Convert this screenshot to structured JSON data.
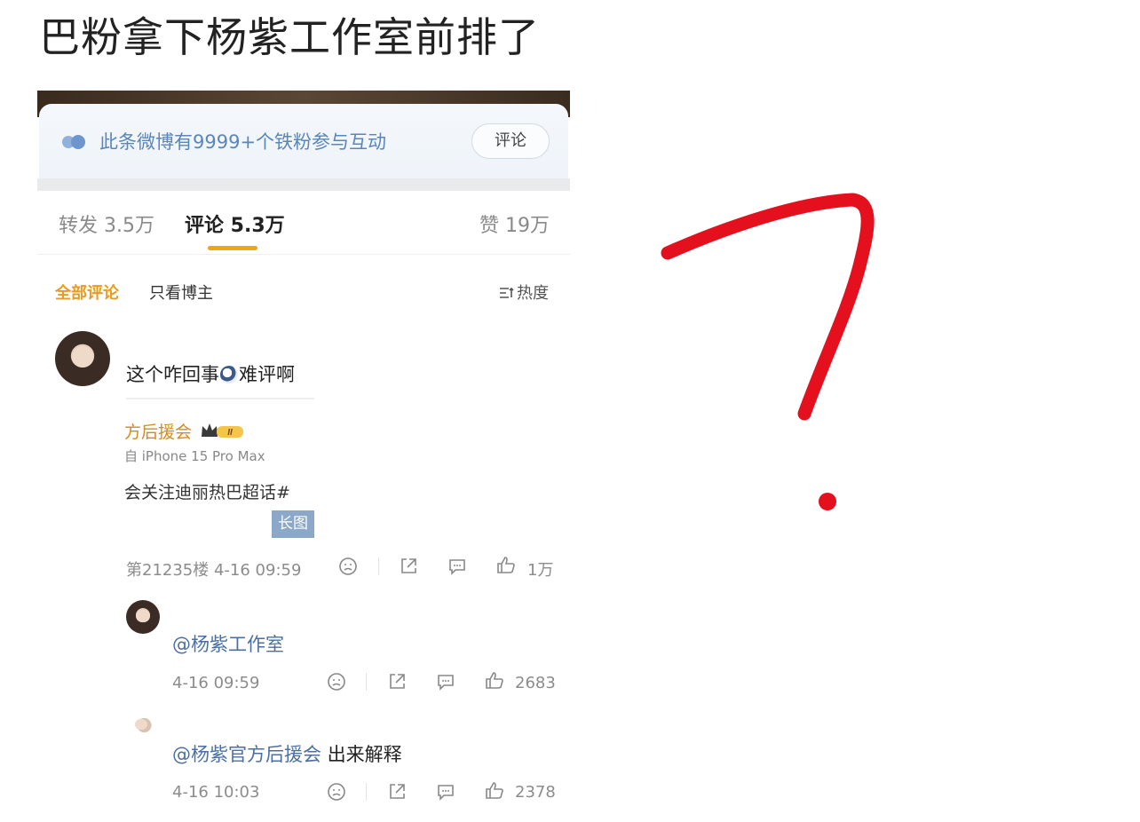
{
  "headline": "巴粉拿下杨紫工作室前排了",
  "fans_banner": {
    "text": "此条微博有9999+个铁粉参与互动",
    "button": "评论"
  },
  "stats": {
    "repost": "转发 3.5万",
    "comment": "评论 5.3万",
    "like": "赞 19万"
  },
  "filters": {
    "all": "全部评论",
    "owner": "只看博主",
    "sort": "热度"
  },
  "comment": {
    "text_before": "这个咋回事",
    "text_after": "难评啊",
    "fan_name": "方后援会",
    "badge_level": "II",
    "device": "自 iPhone 15 Pro Max",
    "topic": "会关注迪丽热巴超话#",
    "long_image_label": "长图",
    "floor_time": "第21235楼 4-16 09:59",
    "likes": "1万"
  },
  "replies": [
    {
      "mention": "@杨紫工作室",
      "rest": "",
      "time": "4-16 09:59",
      "likes": "2683"
    },
    {
      "mention": "@杨紫官方后援会",
      "rest": " 出来解释",
      "time": "4-16 10:03",
      "likes": "2378"
    }
  ],
  "colors": {
    "accent_orange": "#f2a21b",
    "mention_blue": "#4b6fa3",
    "annotation_red": "#e5101d"
  }
}
